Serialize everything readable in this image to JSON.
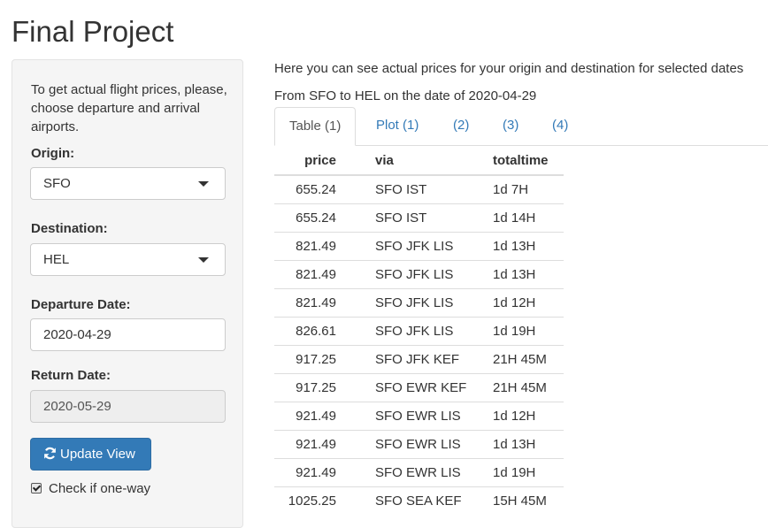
{
  "page": {
    "title": "Final Project"
  },
  "sidebar": {
    "intro": "To get actual flight prices, please, choose departure and arrival airports.",
    "origin": {
      "label": "Origin:",
      "value": "SFO"
    },
    "destination": {
      "label": "Destination:",
      "value": "HEL"
    },
    "departure": {
      "label": "Departure Date:",
      "value": "2020-04-29"
    },
    "return": {
      "label": "Return Date:",
      "value": "2020-05-29"
    },
    "update_button": {
      "label": "Update View",
      "icon": "refresh-icon"
    },
    "one_way": {
      "label": "Check if one-way",
      "checked": true
    }
  },
  "main": {
    "description": "Here you can see actual prices for your origin and destination for selected dates",
    "route": "From SFO to HEL on the date of 2020-04-29",
    "tabs": [
      {
        "label": "Table (1)",
        "active": true
      },
      {
        "label": "Plot (1)",
        "active": false
      },
      {
        "label": "(2)",
        "active": false
      },
      {
        "label": "(3)",
        "active": false
      },
      {
        "label": "(4)",
        "active": false
      }
    ],
    "table": {
      "headers": [
        "price",
        "via",
        "totaltime"
      ],
      "rows": [
        [
          "655.24",
          "SFO IST",
          "1d 7H"
        ],
        [
          "655.24",
          "SFO IST",
          "1d 14H"
        ],
        [
          "821.49",
          "SFO JFK LIS",
          "1d 13H"
        ],
        [
          "821.49",
          "SFO JFK LIS",
          "1d 13H"
        ],
        [
          "821.49",
          "SFO JFK LIS",
          "1d 12H"
        ],
        [
          "826.61",
          "SFO JFK LIS",
          "1d 19H"
        ],
        [
          "917.25",
          "SFO JFK KEF",
          "21H 45M"
        ],
        [
          "917.25",
          "SFO EWR KEF",
          "21H 45M"
        ],
        [
          "921.49",
          "SFO EWR LIS",
          "1d 12H"
        ],
        [
          "921.49",
          "SFO EWR LIS",
          "1d 13H"
        ],
        [
          "921.49",
          "SFO EWR LIS",
          "1d 19H"
        ],
        [
          "1025.25",
          "SFO SEA KEF",
          "15H 45M"
        ]
      ]
    }
  },
  "colors": {
    "accent": "#337ab7",
    "sidebar_bg": "#f5f5f5",
    "border": "#dddddd"
  }
}
